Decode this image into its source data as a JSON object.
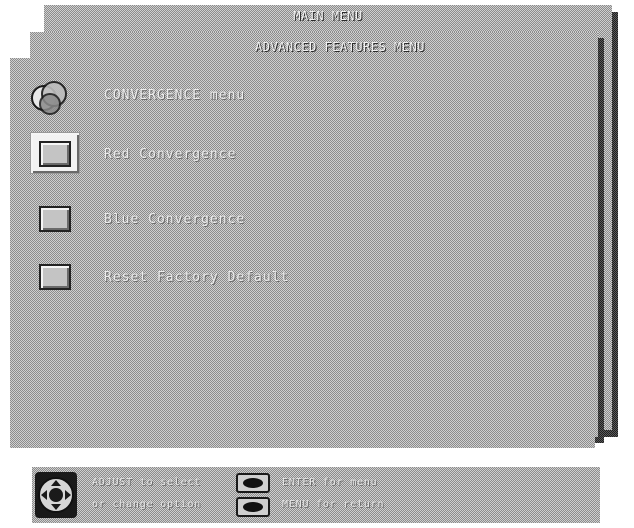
{
  "screen": {
    "main_menu_title": "MAIN MENU",
    "advanced_menu_title": "ADVANCED FEATURES MENU",
    "items": [
      {
        "label": "CONVERGENCE menu",
        "icon": "convergence-icon",
        "selected": false
      },
      {
        "label": "Red Convergence",
        "icon": "button-icon",
        "selected": true
      },
      {
        "label": "Blue Convergence",
        "icon": "button-icon",
        "selected": false
      },
      {
        "label": "Reset Factory Default",
        "icon": "button-icon",
        "selected": false
      }
    ]
  },
  "help_bar": {
    "line1_left": "ADJUST to select",
    "line2_left": "or change option",
    "line1_right": "ENTER for menu",
    "line2_right": "MENU for return"
  }
}
